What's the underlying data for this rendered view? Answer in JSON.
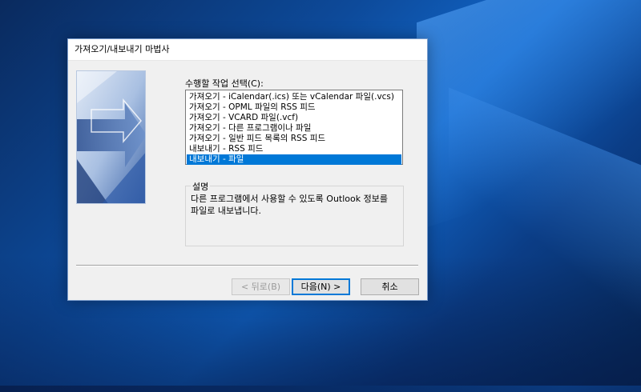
{
  "dialog": {
    "title": "가져오기/내보내기 마법사",
    "prompt_label": "수행할 작업 선택(C):",
    "options": [
      "가져오기 - iCalendar(.ics) 또는 vCalendar 파일(.vcs)",
      "가져오기 - OPML 파일의 RSS 피드",
      "가져오기 - VCARD 파일(.vcf)",
      "가져오기 - 다른 프로그램이나 파일",
      "가져오기 - 일반 피드 목록의 RSS 피드",
      "내보내기 - RSS 피드",
      "내보내기 - 파일"
    ],
    "selected_option": "내보내기 - 파일",
    "description_title": "설명",
    "description_text": "다른 프로그램에서 사용할 수 있도록 Outlook 정보를 파일로 내보냅니다.",
    "buttons": {
      "back": "< 뒤로(B)",
      "next": "다음(N) >",
      "cancel": "취소"
    }
  },
  "colors": {
    "selection": "#0078d7",
    "desktop_accent": "#1166c9"
  }
}
